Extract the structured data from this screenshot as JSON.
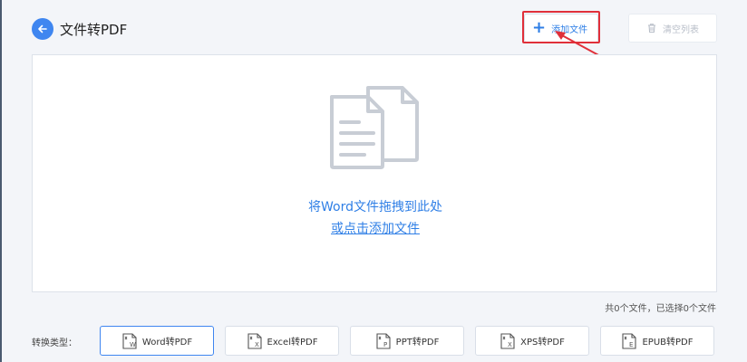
{
  "header": {
    "title": "文件转PDF",
    "add_file_label": "添加文件",
    "clear_list_label": "清空列表"
  },
  "drop_zone": {
    "line1": "将Word文件拖拽到此处",
    "line2": "或点击添加文件"
  },
  "file_count": "共0个文件，已选择0个文件",
  "conversion": {
    "label": "转换类型：",
    "options": [
      {
        "label": "Word转PDF",
        "badge": "W",
        "active": true
      },
      {
        "label": "Excel转PDF",
        "badge": "X",
        "active": false
      },
      {
        "label": "PPT转PDF",
        "badge": "P",
        "active": false
      },
      {
        "label": "XPS转PDF",
        "badge": "X",
        "active": false
      },
      {
        "label": "EPUB转PDF",
        "badge": "E",
        "active": false
      }
    ]
  },
  "colors": {
    "accent": "#2f7fe6",
    "highlight": "#e0303a",
    "background": "#f3f5f9"
  },
  "icons": {
    "back": "arrow-left-icon",
    "add": "plus-icon",
    "clear": "trash-icon",
    "drop": "documents-icon"
  }
}
